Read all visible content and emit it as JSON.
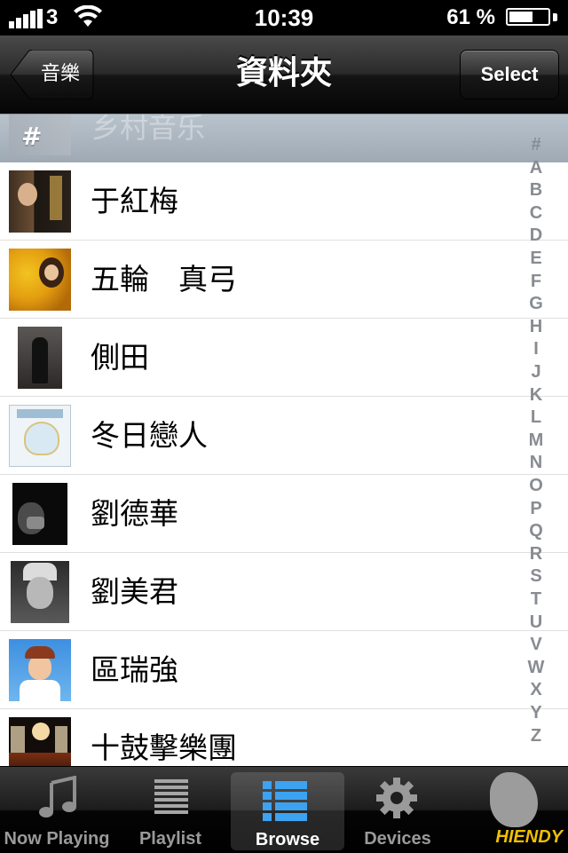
{
  "status_bar": {
    "carrier": "3",
    "time": "10:39",
    "battery_percent": "61 %",
    "battery_level": 0.61,
    "signal_bars": 4
  },
  "nav": {
    "back_label": "音樂",
    "title": "資料夾",
    "select_label": "Select"
  },
  "section": {
    "letter": "#",
    "ghost_text": "乡村音乐"
  },
  "rows": [
    {
      "label": "于紅梅"
    },
    {
      "label": "五輪　真弓"
    },
    {
      "label": "側田"
    },
    {
      "label": "冬日戀人"
    },
    {
      "label": "劉德華"
    },
    {
      "label": "劉美君"
    },
    {
      "label": "區瑞強"
    },
    {
      "label": "十鼓擊樂團"
    }
  ],
  "index_letters": [
    "#",
    "A",
    "B",
    "C",
    "D",
    "E",
    "F",
    "G",
    "H",
    "I",
    "J",
    "K",
    "L",
    "M",
    "N",
    "O",
    "P",
    "Q",
    "R",
    "S",
    "T",
    "U",
    "V",
    "W",
    "X",
    "Y",
    "Z"
  ],
  "tabs": [
    {
      "label": "Now Playing",
      "icon": "music-note-icon"
    },
    {
      "label": "Playlist",
      "icon": "list-icon"
    },
    {
      "label": "Browse",
      "icon": "browse-list-icon",
      "selected": true
    },
    {
      "label": "Devices",
      "icon": "gear-icon"
    },
    {
      "label": "",
      "icon": "more-icon"
    }
  ],
  "watermark": "HIENDY",
  "colors": {
    "browse_accent": "#3da2f0",
    "index_text": "#888c91",
    "section_header": "#a8b3be"
  }
}
